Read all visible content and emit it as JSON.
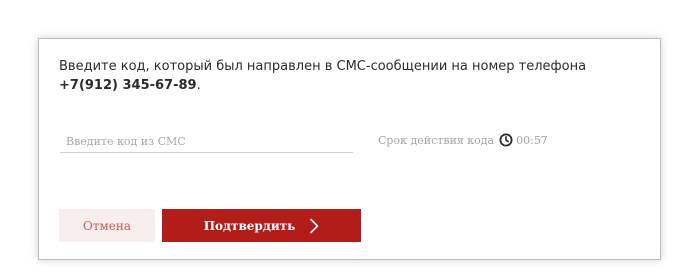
{
  "dialog": {
    "message_text": "Введите код, который был направлен в СМС-сообщении на номер телефона ",
    "phone_number": "+7(912) 345-67-89",
    "message_end": "."
  },
  "code_input": {
    "placeholder": "Введите код из СМС",
    "value": ""
  },
  "timer": {
    "label": "Срок действия кода",
    "icon": "clock-icon",
    "value": "00:57"
  },
  "buttons": {
    "cancel_label": "Отмена",
    "confirm_label": "Подтвердить",
    "confirm_icon": "chevron-right-icon"
  },
  "colors": {
    "accent": "#b21d1a",
    "cancel_bg": "#f8eeee",
    "cancel_text": "#cc5a5a",
    "muted_text": "#a3a3a3"
  }
}
